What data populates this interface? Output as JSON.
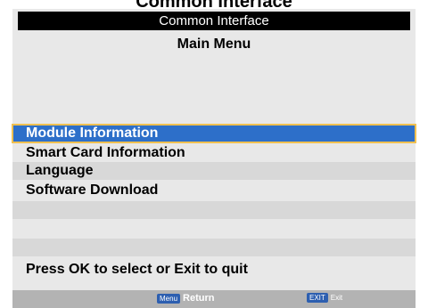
{
  "window": {
    "top_text": "Common Interface",
    "title": "Common Interface",
    "subtitle": "Main Menu"
  },
  "menu": {
    "items": [
      {
        "label": "Module Information",
        "selected": true
      },
      {
        "label": "Smart Card Information",
        "selected": false
      },
      {
        "label": "Language",
        "selected": false
      },
      {
        "label": "Software Download",
        "selected": false
      }
    ]
  },
  "hint": "Press OK to select or Exit to quit",
  "footer": {
    "menu_key": "Menu",
    "menu_action": "Return",
    "exit_key": "EXIT",
    "exit_action": "Exit"
  },
  "colors": {
    "selection": "#2d6fc9",
    "selection_border": "#f0c050",
    "panel": "#e8e8e8",
    "title_bar": "#000000"
  }
}
